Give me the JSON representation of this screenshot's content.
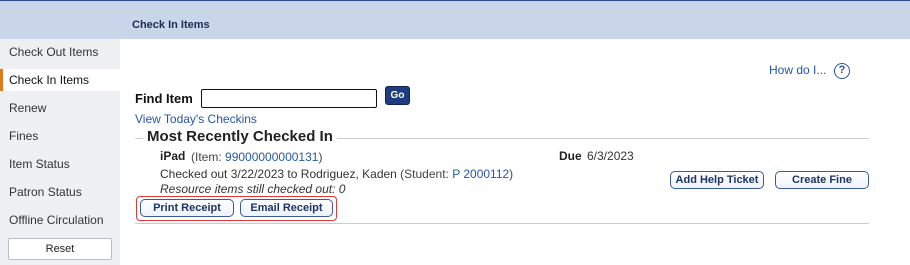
{
  "header": {
    "title": "Check In Items"
  },
  "sidebar": {
    "items": [
      {
        "label": "Check Out Items"
      },
      {
        "label": "Check In Items"
      },
      {
        "label": "Renew"
      },
      {
        "label": "Fines"
      },
      {
        "label": "Item Status"
      },
      {
        "label": "Patron Status"
      },
      {
        "label": "Offline Circulation"
      }
    ],
    "active_index": 1,
    "reset_label": "Reset"
  },
  "help": {
    "link": "How do I...",
    "icon": "?"
  },
  "find": {
    "label": "Find Item",
    "value": "",
    "placeholder": "",
    "go_label": "Go"
  },
  "view_checkins_link": "View Today's Checkins",
  "recent": {
    "section_title": "Most Recently Checked In",
    "item": {
      "name": "iPad",
      "item_prefix": "(Item: ",
      "item_barcode": "99000000000131",
      "item_suffix": ")",
      "due_label": "Due",
      "due_date": "6/3/2023",
      "checked_out_text": "Checked out 3/22/2023 to Rodriguez, Kaden",
      "student_prefix": " (Student: ",
      "student_id": "P 2000112",
      "student_suffix": ")",
      "resource_text": "Resource items still checked out: 0"
    },
    "buttons": {
      "print_receipt": "Print Receipt",
      "email_receipt": "Email Receipt",
      "add_help_ticket": "Add Help Ticket",
      "create_fine": "Create Fine"
    }
  },
  "colors": {
    "header_bg": "#c9d6ea",
    "sidebar_bg": "#eef0f3",
    "link": "#2656a8",
    "active_marker": "#e07a1f",
    "highlight": "#e0393a",
    "go_button": "#1f3c80"
  }
}
